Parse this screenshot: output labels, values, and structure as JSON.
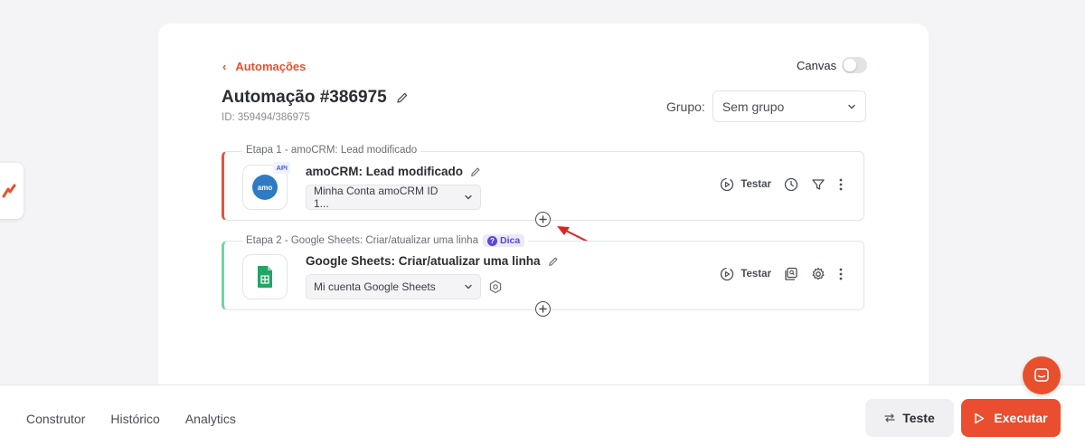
{
  "header": {
    "back_label": "Automações",
    "canvas_label": "Canvas",
    "title": "Automação #386975",
    "id_line": "ID: 359494/386975",
    "group_label": "Grupo:",
    "group_value": "Sem grupo"
  },
  "steps": [
    {
      "label": "Etapa 1 - amoCRM: Lead modificado",
      "name": "amoCRM: Lead modificado",
      "account": "Minha Conta amoCRM ID 1...",
      "badge": "API",
      "icon_text": "amo",
      "test_label": "Testar",
      "accent": "#e9533a"
    },
    {
      "label": "Etapa 2 - Google Sheets: Criar/atualizar uma linha",
      "hint": "Dica",
      "name": "Google Sheets: Criar/atualizar uma linha",
      "account": "Mi cuenta Google Sheets",
      "test_label": "Testar",
      "accent": "#6dd6a0"
    }
  ],
  "bottom": {
    "tabs": [
      "Construtor",
      "Histórico",
      "Analytics"
    ],
    "test_button": "Teste",
    "run_button": "Executar"
  },
  "colors": {
    "brand": "#e8502c",
    "hint": "#5b46d6",
    "sheets_green": "#23a566"
  }
}
